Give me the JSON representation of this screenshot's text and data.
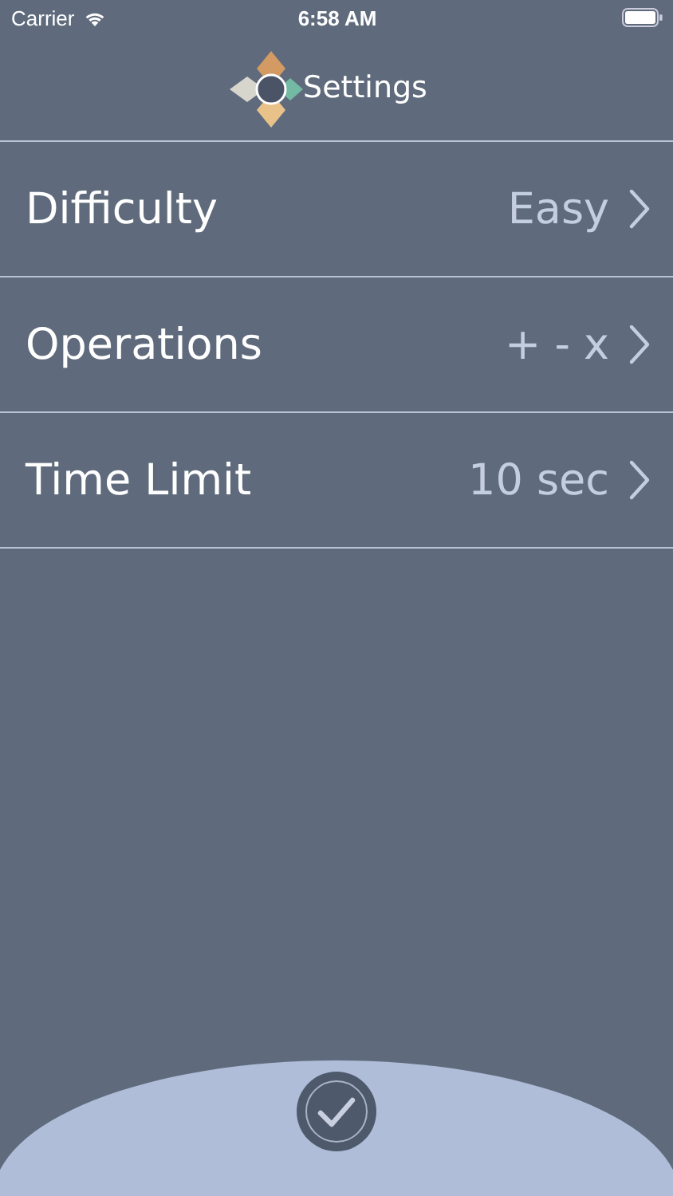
{
  "status_bar": {
    "carrier": "Carrier",
    "time": "6:58 AM"
  },
  "title": "Settings",
  "settings": [
    {
      "label": "Difficulty",
      "value": "Easy"
    },
    {
      "label": "Operations",
      "value": "+ - x"
    },
    {
      "label": "Time Limit",
      "value": "10 sec"
    }
  ]
}
